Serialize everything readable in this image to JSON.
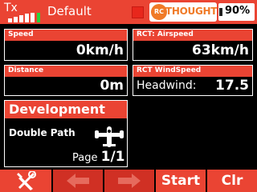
{
  "header": {
    "tx_label": "Tx",
    "model_name": "Default",
    "logo": {
      "rc": "RC",
      "text": "THOUGHTS"
    },
    "battery_percent": "90%",
    "signal_bars": 5
  },
  "tiles": {
    "speed": {
      "title": "Speed",
      "value": "0km/h"
    },
    "airspeed": {
      "title": "RCT: Airspeed",
      "value": "63km/h"
    },
    "distance": {
      "title": "Distance",
      "value": "0m"
    },
    "windspeed": {
      "title": "RCT WindSpeed",
      "label": "Headwind:",
      "value": "17.5"
    }
  },
  "development": {
    "title": "Development",
    "path_name": "Double Path",
    "page_label": "Page",
    "page_number": "1/1"
  },
  "toolbar": {
    "tools_icon": "wrench-screwdriver-icon",
    "left_icon": "arrow-left-icon",
    "right_icon": "arrow-right-icon",
    "start_label": "Start",
    "clear_label": "Clr"
  },
  "colors": {
    "accent": "#ea4433",
    "dim_button": "#d03024",
    "logo_orange": "#f07a27",
    "background": "#000000"
  }
}
